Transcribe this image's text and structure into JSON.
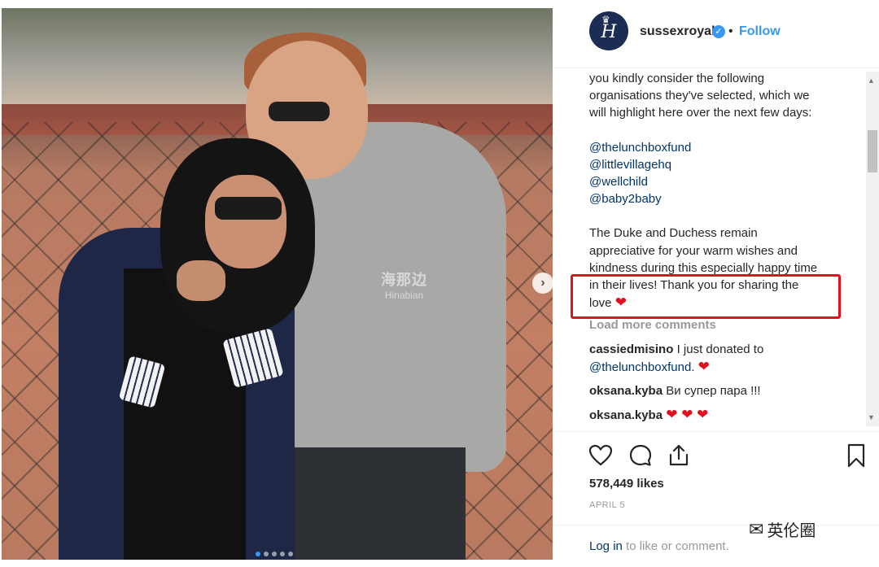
{
  "post": {
    "username": "sussexroyal",
    "follow_label": "Follow",
    "dot": "•",
    "avatar_letter": "H"
  },
  "caption_lines": [
    "you kindly consider the following",
    "organisations they've selected, which we",
    "will highlight here over the next few days:"
  ],
  "mentions": [
    "@thelunchboxfund",
    "@littlevillagehq",
    "@wellchild",
    "@baby2baby"
  ],
  "caption_end_lines": [
    "The Duke and Duchess remain",
    "appreciative for your warm wishes and",
    "kindness during this especially happy time",
    "in their lives! Thank you for sharing the",
    "love"
  ],
  "load_more": "Load more comments",
  "comments": [
    {
      "user": "cassiedmisino",
      "text": "I just donated to",
      "mention": "@thelunchboxfund.",
      "hearts": "❤"
    },
    {
      "user": "oksana.kyba",
      "text": "Ви супер пара !!!"
    },
    {
      "user": "oksana.kyba",
      "text": "",
      "hearts": "❤ ❤ ❤"
    }
  ],
  "likes": "578,449 likes",
  "date": "APRIL 5",
  "login": {
    "link": "Log in",
    "rest": "to like or comment."
  },
  "watermark": {
    "main": "海那边",
    "sub": "Hinabian"
  },
  "wechat_label": "英伦圈",
  "icons": [
    "heart-icon",
    "comment-icon",
    "share-icon",
    "bookmark-icon",
    "verified-icon",
    "chevron-right-icon"
  ],
  "colors": {
    "accent": "#3897f0",
    "mention": "#003569",
    "heart": "#e0111f",
    "highlight": "#e4101e"
  }
}
